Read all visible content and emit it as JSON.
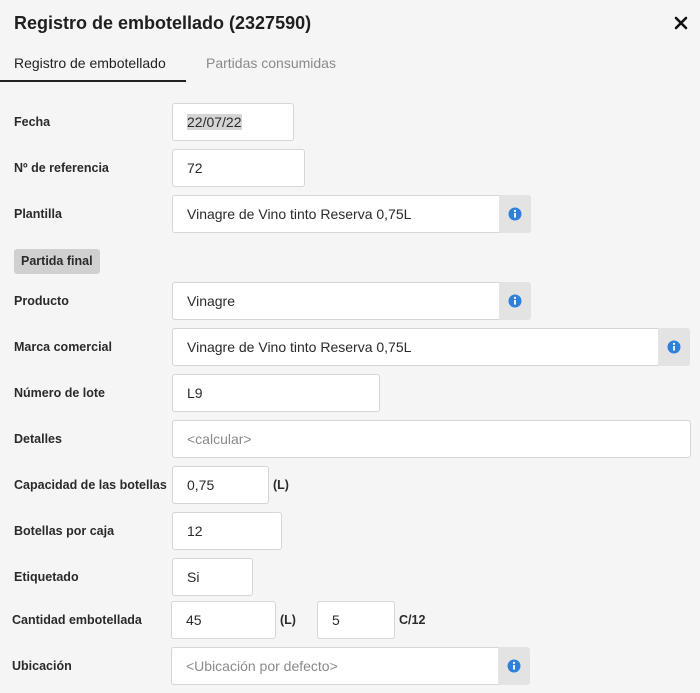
{
  "dialog": {
    "title": "Registro de embotellado (2327590)",
    "close_icon": "close-icon"
  },
  "tabs": [
    {
      "label": "Registro de embotellado",
      "active": true
    },
    {
      "label": "Partidas consumidas",
      "active": false
    }
  ],
  "form": {
    "fecha": {
      "label": "Fecha",
      "value": "22/07/22"
    },
    "referencia": {
      "label": "Nº de referencia",
      "value": "72"
    },
    "plantilla": {
      "label": "Plantilla",
      "value": "Vinagre de Vino tinto Reserva 0,75L",
      "icon": "info-icon"
    },
    "section_label": "Partida final",
    "producto": {
      "label": "Producto",
      "value": "Vinagre",
      "icon": "info-icon"
    },
    "marca": {
      "label": "Marca comercial",
      "value": "Vinagre de Vino tinto Reserva 0,75L",
      "icon": "info-icon"
    },
    "lote": {
      "label": "Número de lote",
      "value": "L9"
    },
    "detalles": {
      "label": "Detalles",
      "placeholder": "<calcular>"
    },
    "capacidad": {
      "label": "Capacidad de las botellas",
      "value": "0,75",
      "unit": "(L)"
    },
    "botellas_caja": {
      "label": "Botellas por caja",
      "value": "12"
    },
    "etiquetado": {
      "label": "Etiquetado",
      "value": "Si"
    },
    "cantidad": {
      "label": "Cantidad embotellada",
      "value": "45",
      "unit": "(L)",
      "cases_value": "5",
      "cases_unit": "C/12"
    },
    "ubicacion": {
      "label": "Ubicación",
      "placeholder": "<Ubicación por defecto>",
      "icon": "info-icon"
    }
  },
  "colors": {
    "info_icon": "#2f80d8",
    "background": "#f5f5f5"
  }
}
